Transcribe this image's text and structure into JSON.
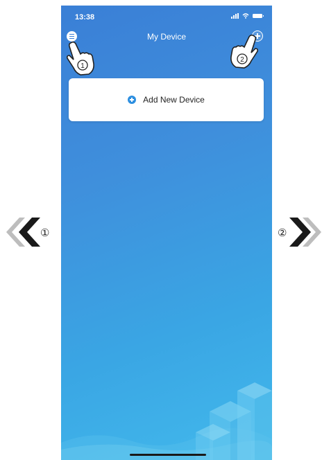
{
  "status": {
    "time": "13:38"
  },
  "header": {
    "title": "My Device"
  },
  "card": {
    "label": "Add New Device"
  },
  "annotations": {
    "hand_1_label": "1",
    "hand_2_label": "2",
    "left_step_label": "①",
    "right_step_label": "②"
  },
  "colors": {
    "accent": "#2d8fe0",
    "background_top": "#3a7fd6",
    "background_bottom": "#42b9ec"
  },
  "icons": {
    "menu": "menu-icon",
    "add": "plus-circle-icon",
    "card_add": "plus-circle-icon",
    "previous": "double-chevron-left-icon",
    "next": "double-chevron-right-icon"
  }
}
